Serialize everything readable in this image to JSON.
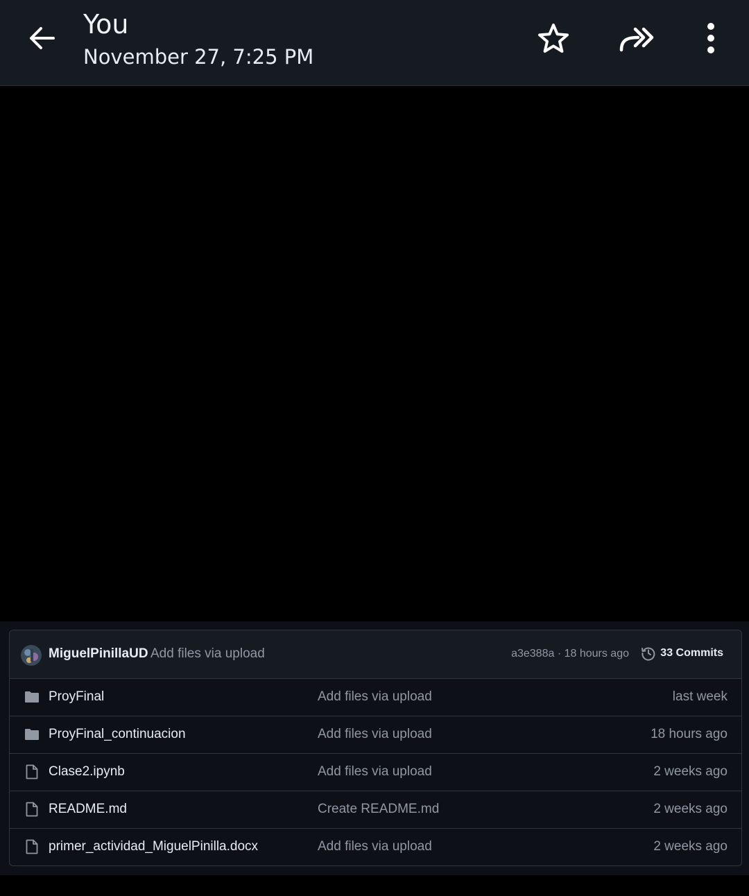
{
  "header": {
    "title": "You",
    "subtitle": "November 27, 7:25 PM",
    "icons": {
      "back": "arrow-left-icon",
      "star": "star-icon",
      "forward": "forward-icon",
      "more": "more-vertical-icon"
    }
  },
  "repo": {
    "commit": {
      "author": "MiguelPinillaUD",
      "message": "Add files via upload",
      "meta": "a3e388a · 18 hours ago",
      "commits_label": "33 Commits"
    },
    "files": [
      {
        "name": "ProyFinal",
        "type": "folder",
        "message": "Add files via upload",
        "time": "last week"
      },
      {
        "name": "ProyFinal_continuacion",
        "type": "folder",
        "message": "Add files via upload",
        "time": "18 hours ago"
      },
      {
        "name": "Clase2.ipynb",
        "type": "file",
        "message": "Add files via upload",
        "time": "2 weeks ago"
      },
      {
        "name": "README.md",
        "type": "file",
        "message": "Create README.md",
        "time": "2 weeks ago"
      },
      {
        "name": "primer_actividad_MiguelPinilla.docx",
        "type": "file",
        "message": "Add files via upload",
        "time": "2 weeks ago"
      }
    ]
  },
  "colors": {
    "header_bg": "#161b22",
    "page_bg": "#000000",
    "repo_bg": "#0d1117",
    "border": "#30363d",
    "text_primary": "#e6edf3",
    "text_muted": "#9198a1"
  }
}
